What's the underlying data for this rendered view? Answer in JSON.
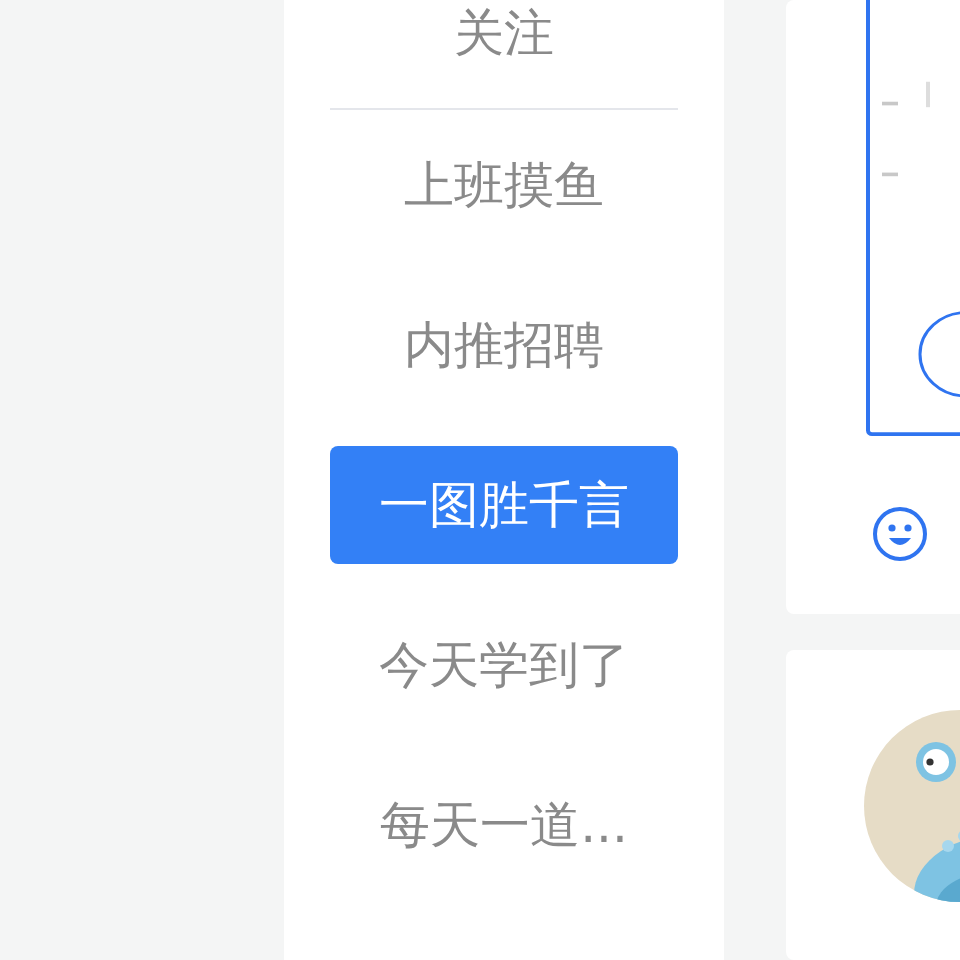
{
  "sidebar": {
    "top_item": {
      "label": "关注"
    },
    "items": [
      {
        "label": "上班摸鱼",
        "selected": false
      },
      {
        "label": "内推招聘",
        "selected": false
      },
      {
        "label": "一图胜千言",
        "selected": true
      },
      {
        "label": "今天学到了",
        "selected": false
      },
      {
        "label": "每天一道...",
        "selected": false
      }
    ]
  },
  "feed": [
    {
      "kind": "image_post"
    },
    {
      "kind": "avatar_post"
    }
  ]
}
